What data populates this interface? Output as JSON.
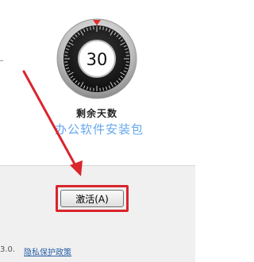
{
  "countdown": {
    "days_value": "30",
    "label": "剩余天数"
  },
  "watermark": {
    "text": "办公软件安装包"
  },
  "activation": {
    "button_label": "激活(A)"
  },
  "footer": {
    "version_text": "3.0.",
    "privacy_link": "隐私保护政策"
  },
  "colors": {
    "annotation_red": "#d9252c",
    "dial_face": "#1a1a1a",
    "dial_marker": "#e0302c",
    "link_blue": "#2a5fa8",
    "watermark_blue": "#4a98ea"
  },
  "icons": {
    "dial_marker": "triangle-marker-icon",
    "annotation_arrow": "red-arrow-icon"
  }
}
